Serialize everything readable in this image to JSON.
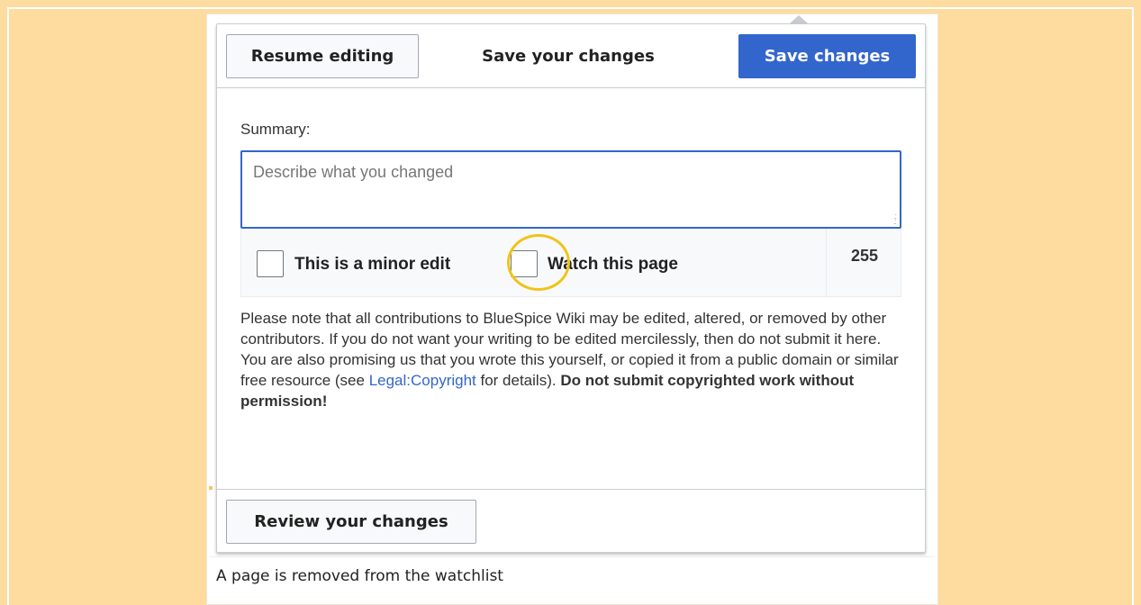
{
  "dialog": {
    "header": {
      "resume_label": "Resume editing",
      "title": "Save your changes",
      "save_label": "Save changes"
    },
    "summary": {
      "label": "Summary:",
      "placeholder": "Describe what you changed",
      "value": ""
    },
    "options": {
      "minor_edit_label": "This is a minor edit",
      "minor_edit_checked": false,
      "watch_label": "Watch this page",
      "watch_checked": false,
      "char_counter": "255"
    },
    "notice": {
      "line1": "Please note that all contributions to BlueSpice Wiki may be edited, altered, or removed by other contributors. If you do not want your writing to be edited mercilessly, then do not submit it here.",
      "line2_before": "You are also promising us that you wrote this yourself, or copied it from a public domain or similar free resource (see ",
      "link": "Legal:Copyright",
      "line2_after": " for details). ",
      "warning": "Do not submit copyrighted work without permission!"
    },
    "footer": {
      "review_label": "Review your changes"
    }
  },
  "caption": "A page is removed from the watchlist",
  "colors": {
    "page_background": "#fedb9e",
    "primary": "#3366cc",
    "highlight_ring": "#f0c419"
  }
}
